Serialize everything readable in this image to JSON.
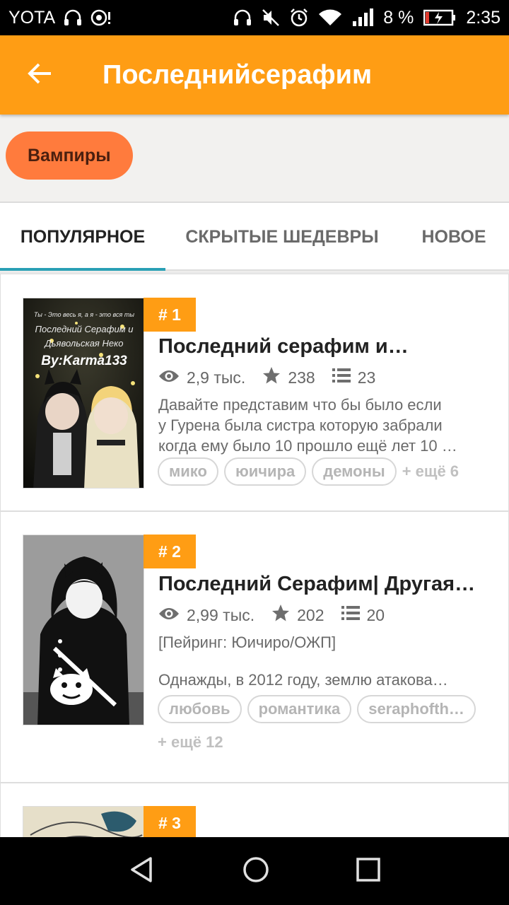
{
  "status": {
    "carrier": "YOTA",
    "battery": "8 %",
    "time": "2:35"
  },
  "header": {
    "title": "Последнийсерафим"
  },
  "category_chip": "Вампиры",
  "tabs": [
    {
      "label": "ПОПУЛЯРНОЕ"
    },
    {
      "label": "СКРЫТЫЕ ШЕДЕВРЫ"
    },
    {
      "label": "НОВОЕ"
    }
  ],
  "stories": [
    {
      "rank": "# 1",
      "title": "Последний серафим и…",
      "views": "2,9 тыс.",
      "votes": "238",
      "parts": "23",
      "desc_lines": [
        "Давайте представим что бы было если",
        "у Гурена была систра которую забрали",
        "когда ему было 10 прошло ещё лет 10 …"
      ],
      "tags": [
        "мико",
        "юичира",
        "демоны"
      ],
      "more": "+ ещё 6",
      "cover_text": [
        "Ты - Это весь я, а я - это вся ты",
        "Последний Серафим и",
        "Дьявольская Неко",
        "By:Karma133"
      ]
    },
    {
      "rank": "# 2",
      "title": "Последний Серафим| Другая…",
      "views": "2,99 тыс.",
      "votes": "202",
      "parts": "20",
      "pairing": "[Пейринг: Юичиро/ОЖП]",
      "desc": "Однажды, в 2012 году, землю атакова…",
      "tags": [
        "любовь",
        "романтика",
        "seraphofth…"
      ],
      "more": "+ ещё 12"
    },
    {
      "rank": "# 3"
    }
  ]
}
